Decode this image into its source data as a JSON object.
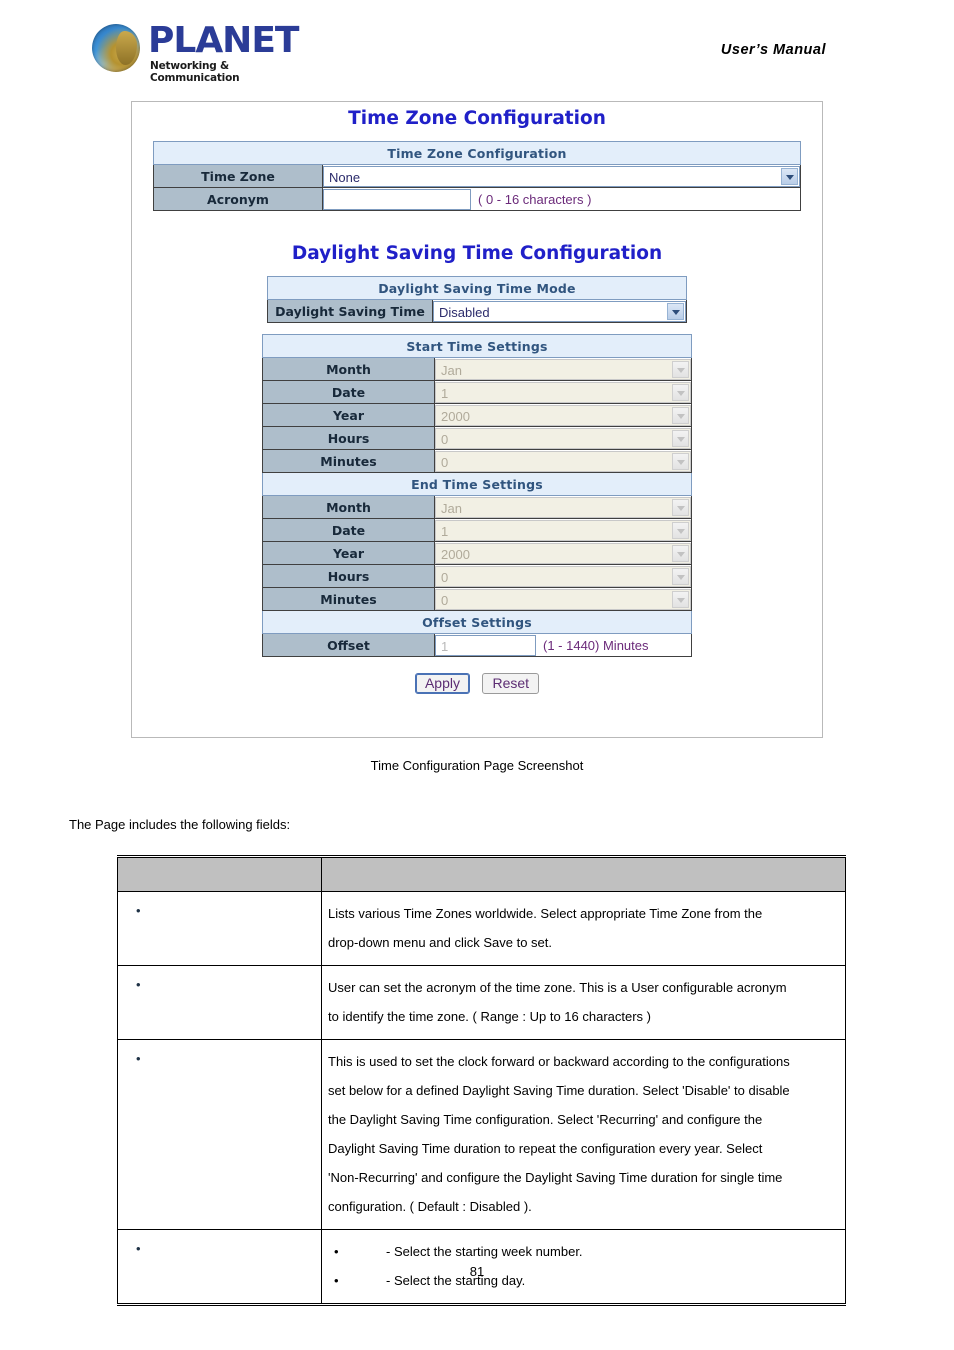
{
  "header": {
    "brand": "PLANET",
    "brand_tagline": "Networking & Communication",
    "document_title": "User’s  Manual"
  },
  "screenshot": {
    "title_timezone": "Time Zone Configuration",
    "title_dst": "Daylight Saving Time Configuration",
    "timezone_table": {
      "section_header": "Time Zone Configuration",
      "rows": [
        {
          "label": "Time Zone",
          "widget": "select",
          "value": "None"
        },
        {
          "label": "Acronym",
          "widget": "text",
          "value": "",
          "hint": "( 0 - 16 characters )"
        }
      ]
    },
    "dst_mode_table": {
      "section_header": "Daylight Saving Time Mode",
      "rows": [
        {
          "label": "Daylight Saving Time",
          "widget": "select",
          "value": "Disabled"
        }
      ]
    },
    "dst_detail_table": {
      "start_header": "Start Time Settings",
      "start_rows": [
        {
          "label": "Month",
          "value": "Jan"
        },
        {
          "label": "Date",
          "value": "1"
        },
        {
          "label": "Year",
          "value": "2000"
        },
        {
          "label": "Hours",
          "value": "0"
        },
        {
          "label": "Minutes",
          "value": "0"
        }
      ],
      "end_header": "End Time Settings",
      "end_rows": [
        {
          "label": "Month",
          "value": "Jan"
        },
        {
          "label": "Date",
          "value": "1"
        },
        {
          "label": "Year",
          "value": "2000"
        },
        {
          "label": "Hours",
          "value": "0"
        },
        {
          "label": "Minutes",
          "value": "0"
        }
      ],
      "offset_header": "Offset Settings",
      "offset_row": {
        "label": "Offset",
        "value": "1",
        "hint": "(1 - 1440) Minutes"
      }
    },
    "buttons": {
      "apply": "Apply",
      "reset": "Reset"
    }
  },
  "caption": "Time Configuration Page Screenshot",
  "intro_text": "The Page includes the following fields:",
  "fields_table": {
    "headers": {
      "object": "",
      "description": ""
    },
    "rows": [
      {
        "object": "",
        "description_lines": [
          "Lists various Time Zones worldwide. Select appropriate Time Zone from the",
          "drop-down menu and click Save to set."
        ]
      },
      {
        "object": "",
        "description_lines": [
          "User can set the acronym of the time zone. This is a User configurable acronym",
          "to identify the time zone. ( Range : Up to 16 characters )"
        ]
      },
      {
        "object": "",
        "description_lines": [
          "This is used to set the clock forward or backward according to the configurations",
          "set below for a defined Daylight Saving Time duration. Select 'Disable' to disable",
          "the Daylight Saving Time configuration. Select 'Recurring' and configure the",
          "Daylight Saving Time duration to repeat the configuration every year. Select",
          "'Non-Recurring' and configure the Daylight Saving Time duration for single time",
          "configuration. ( Default : Disabled )."
        ]
      },
      {
        "object": "",
        "sub_items": [
          "- Select the starting week number.",
          "- Select the starting day."
        ]
      }
    ]
  },
  "page_number": "81"
}
